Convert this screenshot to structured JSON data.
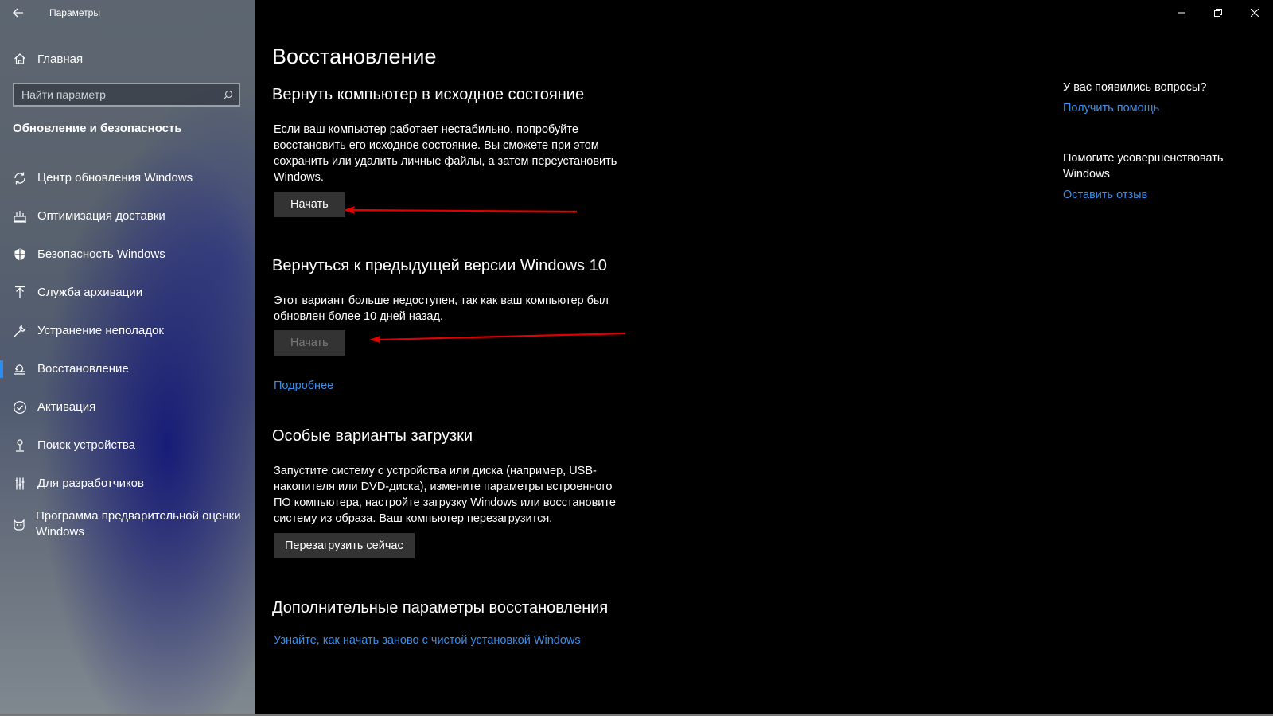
{
  "window": {
    "app_title": "Параметры",
    "controls": {
      "minimize": "minimize-icon",
      "restore": "restore-icon",
      "close": "close-icon"
    }
  },
  "sidebar": {
    "home_label": "Главная",
    "search_placeholder": "Найти параметр",
    "section_title": "Обновление и безопасность",
    "items": [
      {
        "label": "Центр обновления Windows",
        "icon": "sync-icon"
      },
      {
        "label": "Оптимизация доставки",
        "icon": "delivery-icon"
      },
      {
        "label": "Безопасность Windows",
        "icon": "shield-icon"
      },
      {
        "label": "Служба архивации",
        "icon": "backup-icon"
      },
      {
        "label": "Устранение неполадок",
        "icon": "wrench-icon"
      },
      {
        "label": "Восстановление",
        "icon": "recovery-icon",
        "active": true
      },
      {
        "label": "Активация",
        "icon": "activation-icon"
      },
      {
        "label": "Поиск устройства",
        "icon": "find-device-icon"
      },
      {
        "label": "Для разработчиков",
        "icon": "developer-icon"
      },
      {
        "label": "Программа предварительной оценки Windows",
        "icon": "insider-icon"
      }
    ]
  },
  "main": {
    "title": "Восстановление",
    "reset": {
      "heading": "Вернуть компьютер в исходное состояние",
      "text": "Если ваш компьютер работает нестабильно, попробуйте восстановить его исходное состояние. Вы сможете при этом сохранить или удалить личные файлы, а затем переустановить Windows.",
      "button": "Начать"
    },
    "rollback": {
      "heading": "Вернуться к предыдущей версии Windows 10",
      "text": "Этот вариант больше недоступен, так как ваш компьютер был обновлен более 10 дней назад.",
      "button": "Начать",
      "link": "Подробнее"
    },
    "advanced_startup": {
      "heading": "Особые варианты загрузки",
      "text": "Запустите систему с устройства или диска (например, USB-накопителя или DVD-диска), измените параметры встроенного ПО компьютера, настройте загрузку Windows или восстановите систему из образа. Ваш компьютер перезагрузится.",
      "button": "Перезагрузить сейчас"
    },
    "more_options": {
      "heading": "Дополнительные параметры восстановления",
      "link": "Узнайте, как начать заново с чистой установкой Windows"
    }
  },
  "right_panel": {
    "questions": "У вас появились вопросы?",
    "get_help": "Получить помощь",
    "improve": "Помогите усовершенствовать Windows",
    "feedback": "Оставить отзыв"
  },
  "colors": {
    "accent": "#3b8ee6",
    "annotation_arrow": "#e00000",
    "button_bg": "#333333"
  }
}
